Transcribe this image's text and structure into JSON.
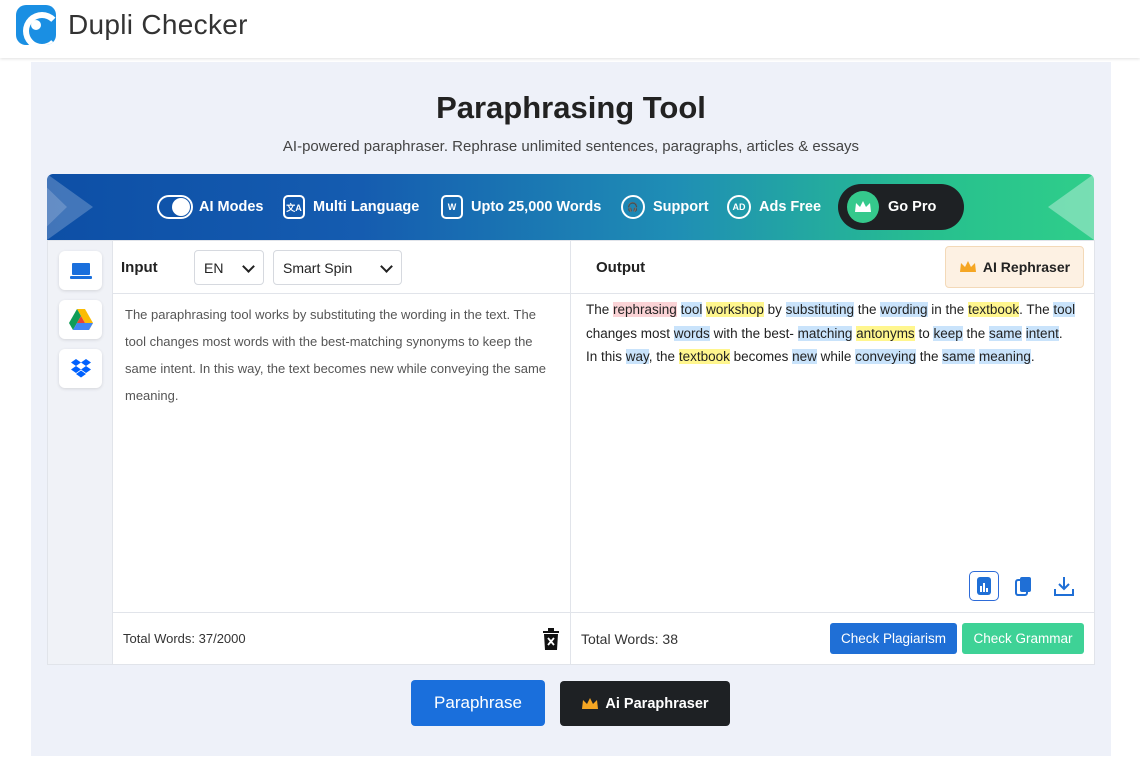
{
  "header": {
    "brand": "Dupli Checker"
  },
  "page": {
    "title": "Paraphrasing Tool",
    "subtitle": "AI-powered paraphraser. Rephrase unlimited sentences, paragraphs, articles & essays"
  },
  "features": {
    "ai_modes": "AI Modes",
    "multi_language": "Multi Language",
    "word_limit": "Upto 25,000 Words",
    "support": "Support",
    "ads_free": "Ads Free",
    "go_pro": "Go Pro"
  },
  "input": {
    "label": "Input",
    "language": "EN",
    "mode": "Smart Spin",
    "text": "The paraphrasing tool works by substituting the wording in the text. The tool changes most words with the best-matching synonyms to keep the same intent. In this way, the text becomes new while conveying the same meaning.",
    "word_count": "Total Words: 37/2000"
  },
  "output": {
    "label": "Output",
    "ai_rephraser": "AI Rephraser",
    "segments": [
      {
        "t": "The ",
        "h": ""
      },
      {
        "t": "rephrasing",
        "h": "red"
      },
      {
        "t": " ",
        "h": ""
      },
      {
        "t": "tool",
        "h": "blue"
      },
      {
        "t": " ",
        "h": ""
      },
      {
        "t": "workshop",
        "h": "yel"
      },
      {
        "t": " by ",
        "h": ""
      },
      {
        "t": "substituting",
        "h": "blue"
      },
      {
        "t": " the ",
        "h": ""
      },
      {
        "t": "wording",
        "h": "blue"
      },
      {
        "t": " in the ",
        "h": ""
      },
      {
        "t": "textbook",
        "h": "yel"
      },
      {
        "t": ". The ",
        "h": ""
      },
      {
        "t": "tool",
        "h": "blue"
      },
      {
        "t": " changes most ",
        "h": ""
      },
      {
        "t": "words",
        "h": "blue"
      },
      {
        "t": " with the best- ",
        "h": ""
      },
      {
        "t": "matching",
        "h": "blue"
      },
      {
        "t": " ",
        "h": ""
      },
      {
        "t": "antonyms",
        "h": "yel"
      },
      {
        "t": " to ",
        "h": ""
      },
      {
        "t": "keep",
        "h": "blue"
      },
      {
        "t": " the ",
        "h": ""
      },
      {
        "t": "same",
        "h": "blue"
      },
      {
        "t": " ",
        "h": ""
      },
      {
        "t": "intent",
        "h": "blue"
      },
      {
        "t": ". In this ",
        "h": ""
      },
      {
        "t": "way",
        "h": "blue"
      },
      {
        "t": ", the ",
        "h": ""
      },
      {
        "t": "textbook",
        "h": "yel"
      },
      {
        "t": " becomes ",
        "h": ""
      },
      {
        "t": "new",
        "h": "blue"
      },
      {
        "t": " while ",
        "h": ""
      },
      {
        "t": "conveying",
        "h": "blue"
      },
      {
        "t": " the ",
        "h": ""
      },
      {
        "t": "same",
        "h": "blue"
      },
      {
        "t": " ",
        "h": ""
      },
      {
        "t": "meaning",
        "h": "blue"
      },
      {
        "t": ".",
        "h": ""
      }
    ],
    "word_count": "Total Words: 38",
    "check_plagiarism": "Check Plagiarism",
    "check_grammar": "Check Grammar"
  },
  "actions": {
    "paraphrase": "Paraphrase",
    "ai_paraphraser": "Ai Paraphraser"
  },
  "colors": {
    "primary_blue": "#1a6fdc",
    "green": "#3ed296",
    "dark": "#1e2124",
    "highlight_red": "#fbd3d6",
    "highlight_yellow": "#fff68e",
    "highlight_blue": "#c9e3fb"
  },
  "icons": {
    "upload": "laptop-icon",
    "drive": "google-drive-icon",
    "dropbox": "dropbox-icon",
    "delete": "trash-icon",
    "stats": "chart-icon",
    "copy": "copy-icon",
    "download": "download-icon",
    "crown": "crown-icon"
  }
}
